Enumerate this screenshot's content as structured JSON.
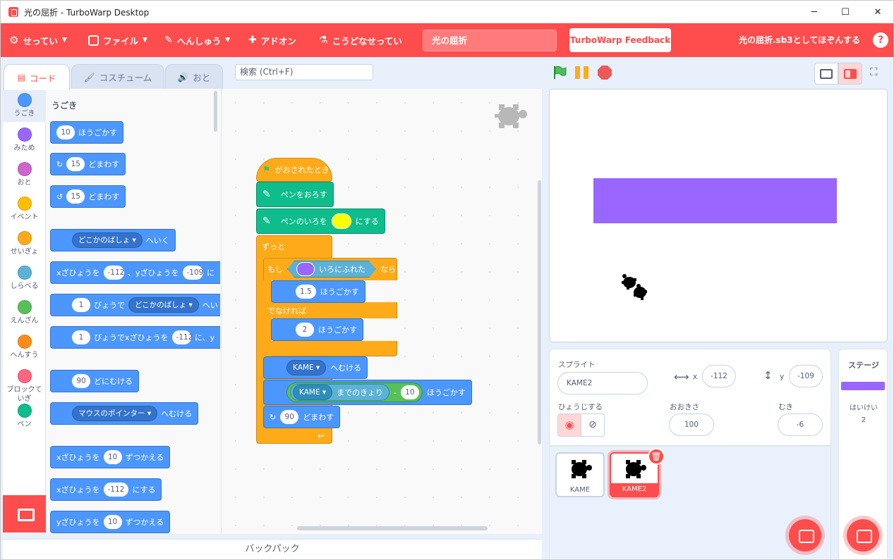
{
  "window": {
    "title": "光の屈折 - TurboWarp Desktop",
    "controls": [
      "─",
      "☐",
      "✕"
    ]
  },
  "menubar": {
    "settings": "せってい",
    "file": "ファイル",
    "edit": "へんしゅう",
    "addons": "アドオン",
    "advanced": "こうどなせってい",
    "project_title": "光の屈折",
    "feedback": "TurboWarp Feedback",
    "save_as": "光の屈折.sb3としてほぞんする",
    "help": "?"
  },
  "tabs": {
    "code": "コード",
    "costumes": "コスチューム",
    "sounds": "おと"
  },
  "search": {
    "placeholder": "検索 (Ctrl+F)"
  },
  "categories": [
    {
      "label": "うごき",
      "color": "#4c97ff"
    },
    {
      "label": "みため",
      "color": "#9966ff"
    },
    {
      "label": "おと",
      "color": "#cf63cf"
    },
    {
      "label": "イベント",
      "color": "#ffbf00"
    },
    {
      "label": "せいぎょ",
      "color": "#ffab19"
    },
    {
      "label": "しらべる",
      "color": "#5cb1d6"
    },
    {
      "label": "えんざん",
      "color": "#59c059"
    },
    {
      "label": "へんすう",
      "color": "#ff8c1a"
    },
    {
      "label": "ブロックて\nいぎ",
      "color": "#ff6680"
    },
    {
      "label": "ペン",
      "color": "#0fbd8c"
    }
  ],
  "palette": {
    "heading": "うごき",
    "move": {
      "value": "10",
      "text": "ほうごかす"
    },
    "turn_right": {
      "value": "15",
      "text": "どまわす"
    },
    "turn_left": {
      "value": "15",
      "text": "どまわす"
    },
    "goto": {
      "menu": "どこかのばしょ ▾",
      "text": "へいく"
    },
    "goto_xy": {
      "t1": "xざひょうを",
      "x": "-112",
      "t2": "、yざひょうを",
      "y": "-109",
      "t3": "に"
    },
    "glide": {
      "secs": "1",
      "t1": "びょうで",
      "menu": "どこかのばしょ ▾",
      "t2": "へい"
    },
    "glide_xy": {
      "secs": "1",
      "t1": "びょうでxざひょうを",
      "x": "-112",
      "t2": "に、y"
    },
    "point_dir": {
      "value": "90",
      "text": "どにむける"
    },
    "point_towards": {
      "menu": "マウスのポインター ▾",
      "text": "へむける"
    },
    "change_x": {
      "t1": "xざひょうを",
      "value": "10",
      "t2": "ずつかえる"
    },
    "set_x": {
      "t1": "xざひょうを",
      "value": "-112",
      "t2": "にする"
    },
    "change_y": {
      "t1": "yざひょうを",
      "value": "10",
      "t2": "ずつかえる"
    }
  },
  "script": {
    "hat": "がおされたとき",
    "pen_down": "ペンをおろす",
    "pen_color_t1": "ペンのいろを",
    "pen_color_t2": "にする",
    "pen_color_value": "#ffff00",
    "forever": "ずっと",
    "if_label": "もし",
    "touching_color": "#9966ff",
    "touching_text": "いろにふれた",
    "then": "なら",
    "move1": "1.5",
    "move_text": "ほうごかす",
    "else": "でなければ",
    "move2": "2",
    "point_towards_menu": "KAME ▾",
    "point_towards_text": "へむける",
    "distance_menu": "KAME ▾",
    "distance_text": "までのきょり",
    "minus": "-",
    "minus_value": "10",
    "move3_text": "ほうごかす",
    "turn_value": "90",
    "turn_text": "どまわす"
  },
  "backpack": "バックパック",
  "sprite_info": {
    "sprite_label": "スプライト",
    "sprite_name": "KAME2",
    "x_label": "x",
    "x": "-112",
    "y_label": "y",
    "y": "-109",
    "show_label": "ひょうじする",
    "size_label": "おおきさ",
    "size": "100",
    "dir_label": "むき",
    "direction": "-6"
  },
  "sprites": [
    {
      "name": "KAME"
    },
    {
      "name": "KAME2"
    }
  ],
  "stage_pane": {
    "title": "ステージ",
    "backdrops_label": "はいけい",
    "backdrops_count": "2"
  }
}
